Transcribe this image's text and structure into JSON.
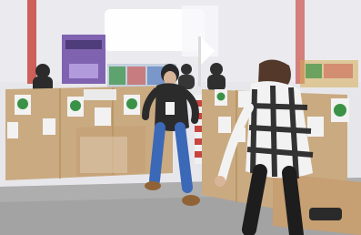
{
  "scene": {
    "kind": "photo",
    "subject": "",
    "text": []
  },
  "colors": {
    "plywood": "#c7a57a",
    "plywood_dark": "#b7925f",
    "floor": "#9e9e9e",
    "wall": "#e9e9ee",
    "window": "#ffffff",
    "dark": "#1d1d1d",
    "accent_red": "#c43a33",
    "accent_blue": "#2f5fb3",
    "accent_green": "#2f8c3b",
    "skin": "#d6b192"
  },
  "objects": [
    {
      "name": "plywood-walls",
      "icon": "plywood"
    },
    {
      "name": "person-left",
      "icon": "person"
    },
    {
      "name": "person-right",
      "icon": "person"
    },
    {
      "name": "poster-banner",
      "icon": "poster"
    },
    {
      "name": "green-circle-signs",
      "icon": "sign"
    },
    {
      "name": "red-stripe-pole",
      "icon": "pole"
    }
  ]
}
